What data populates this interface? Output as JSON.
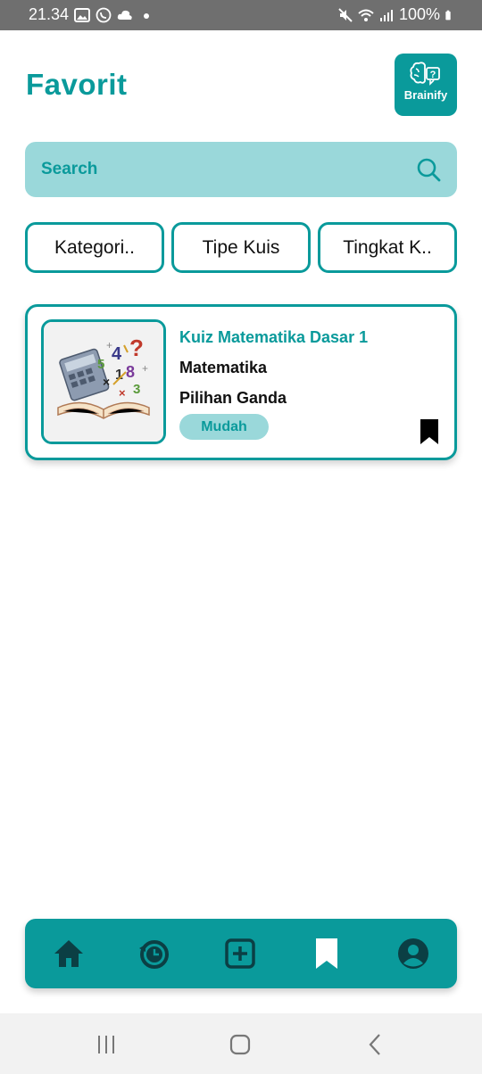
{
  "status_bar": {
    "time": "21.34",
    "battery": "100%"
  },
  "header": {
    "title": "Favorit",
    "logo_text": "Brainify"
  },
  "search": {
    "placeholder": "Search"
  },
  "filters": [
    {
      "label": "Kategori.."
    },
    {
      "label": "Tipe Kuis"
    },
    {
      "label": "Tingkat K.."
    }
  ],
  "quizzes": [
    {
      "title": "Kuiz Matematika Dasar 1",
      "category": "Matematika",
      "type": "Pilihan Ganda",
      "difficulty": "Mudah",
      "bookmarked": true,
      "thumbnail_icon": "math-book-illustration"
    }
  ],
  "bottom_nav": {
    "items": [
      "home-icon",
      "history-icon",
      "add-icon",
      "bookmark-icon",
      "profile-icon"
    ],
    "active": "bookmark-icon"
  },
  "colors": {
    "primary": "#0a9a9b",
    "light": "#9ad8da",
    "status_bar": "#6f6f6f"
  }
}
